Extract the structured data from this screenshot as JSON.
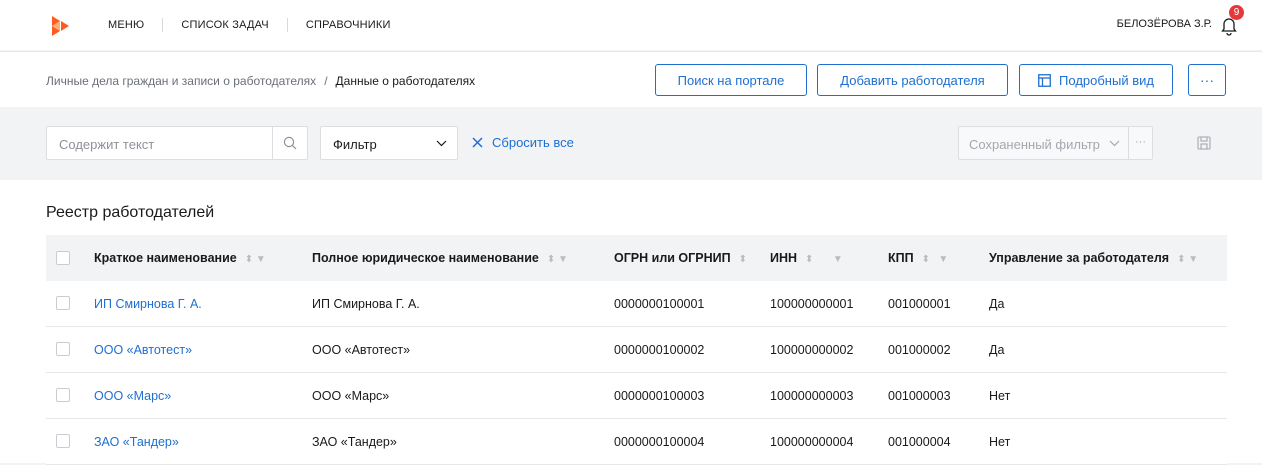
{
  "nav": {
    "items": [
      "МЕНЮ",
      "СПИСОК ЗАДАЧ",
      "СПРАВОЧНИКИ"
    ],
    "user": "БЕЛОЗЁРОВА З.Р.",
    "notifications_count": "9"
  },
  "breadcrumb": {
    "parent": "Личные дела граждан и записи о работодателях",
    "separator": "/",
    "current": "Данные о работодателях"
  },
  "actions": {
    "search_portal": "Поиск на портале",
    "add_employer": "Добавить работодателя",
    "detail_view": "Подробный вид",
    "more": "···"
  },
  "filters": {
    "search_placeholder": "Содержит текст",
    "filter_label": "Фильтр",
    "reset_all": "Сбросить все",
    "saved_filter_placeholder": "Сохраненный фильтр",
    "saved_more": "···"
  },
  "table": {
    "title": "Реестр работодателей",
    "columns": [
      "Краткое наименование",
      "Полное юридическое наименование",
      "ОГРН или ОГРНИП",
      "ИНН",
      "КПП",
      "Управление за работодателя"
    ],
    "rows": [
      {
        "short": "ИП Смирнова Г. А.",
        "full": "ИП Смирнова Г. А.",
        "ogrn": "0000000100001",
        "inn": "100000000001",
        "kpp": "001000001",
        "manage": "Да"
      },
      {
        "short": "ООО «Автотест»",
        "full": "ООО «Автотест»",
        "ogrn": "0000000100002",
        "inn": "100000000002",
        "kpp": "001000002",
        "manage": "Да"
      },
      {
        "short": "ООО «Марс»",
        "full": "ООО «Марс»",
        "ogrn": "0000000100003",
        "inn": "100000000003",
        "kpp": "001000003",
        "manage": "Нет"
      },
      {
        "short": "ЗАО «Тандер»",
        "full": "ЗАО «Тандер»",
        "ogrn": "0000000100004",
        "inn": "100000000004",
        "kpp": "001000004",
        "manage": "Нет"
      }
    ]
  },
  "colors": {
    "accent": "#1f6fd1",
    "badge": "#e5383b",
    "logo": "#ff5a1f"
  }
}
